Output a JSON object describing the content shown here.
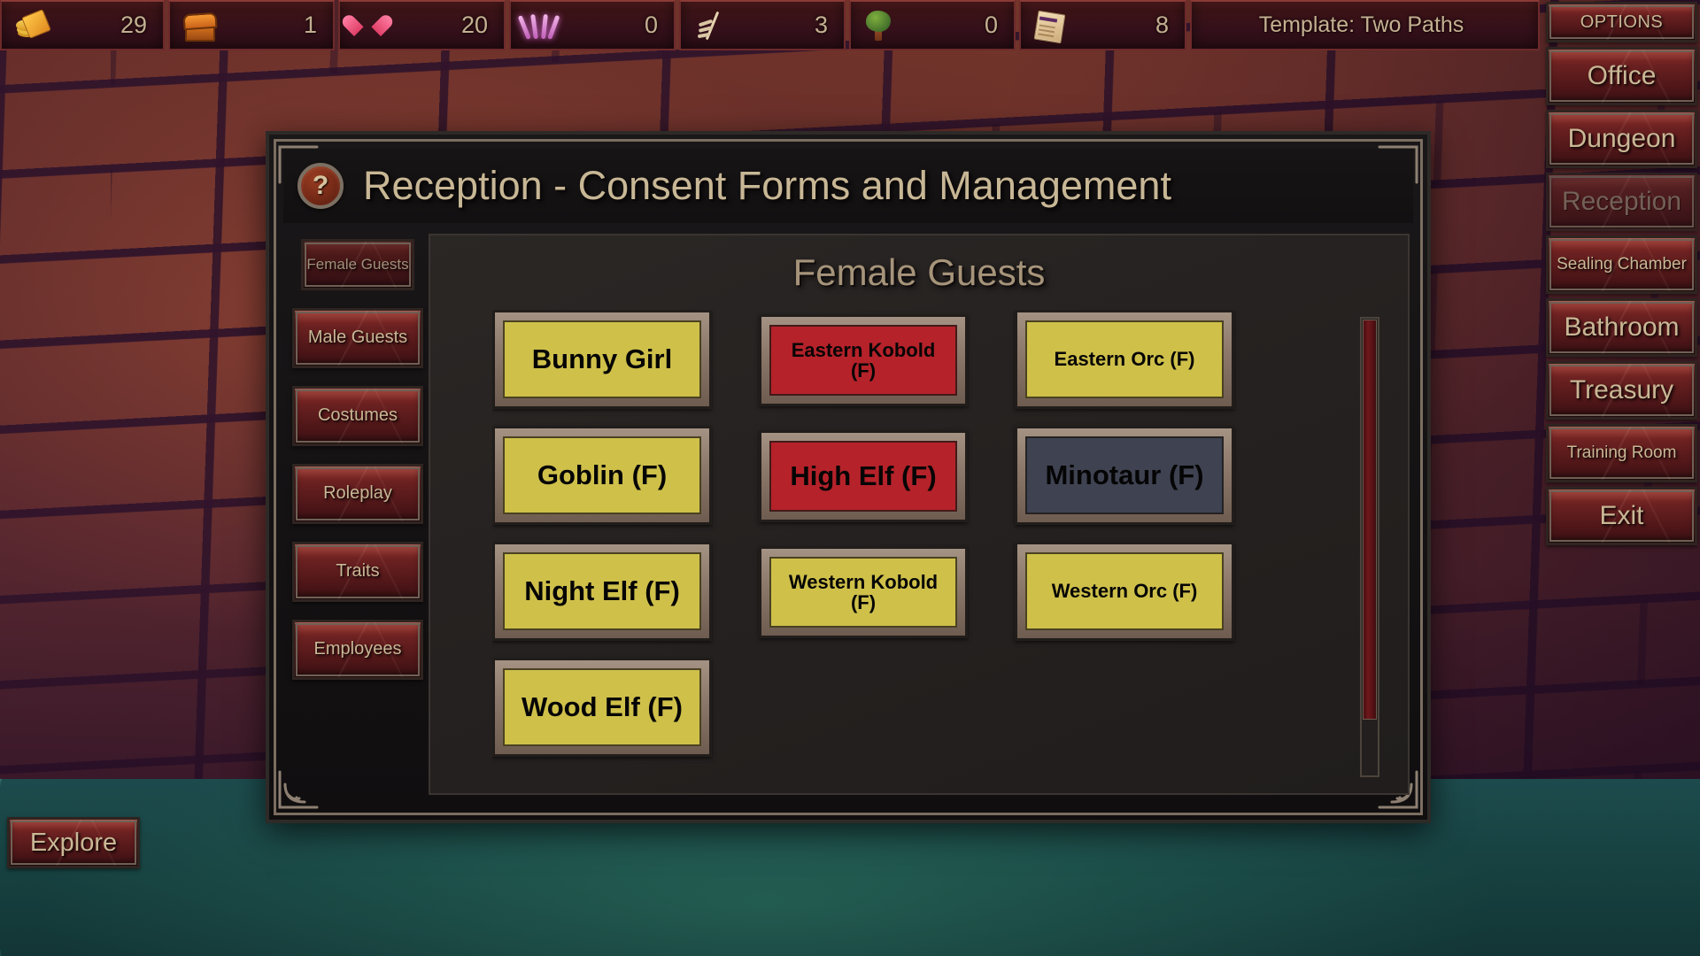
{
  "topbar": {
    "resources": [
      {
        "icon": "gold-coins-icon",
        "id": "cell-gold",
        "value": "29"
      },
      {
        "icon": "treasure-chest-icon",
        "id": "cell-chest",
        "value": "1"
      },
      {
        "icon": "heart-icon",
        "id": "cell-heart",
        "value": "20"
      },
      {
        "icon": "magic-bone-icon",
        "id": "cell-bone",
        "value": "0"
      },
      {
        "icon": "skeleton-spear-icon",
        "id": "cell-skel",
        "value": "3"
      },
      {
        "icon": "tree-icon",
        "id": "cell-wood",
        "value": "0"
      },
      {
        "icon": "scroll-papers-icon",
        "id": "cell-scroll",
        "value": "8"
      }
    ],
    "template_label": "Template: Two Paths"
  },
  "rightnav": {
    "options_label": "OPTIONS",
    "rooms": [
      {
        "label": "Office",
        "size": "large",
        "state": "normal"
      },
      {
        "label": "Dungeon",
        "size": "large",
        "state": "normal"
      },
      {
        "label": "Reception",
        "size": "large",
        "state": "current"
      },
      {
        "label": "Sealing Chamber",
        "size": "small",
        "state": "normal"
      },
      {
        "label": "Bathroom",
        "size": "large",
        "state": "normal"
      },
      {
        "label": "Treasury",
        "size": "large",
        "state": "normal"
      },
      {
        "label": "Training Room",
        "size": "small",
        "state": "normal"
      },
      {
        "label": "Exit",
        "size": "large",
        "state": "normal"
      }
    ]
  },
  "explore_label": "Explore",
  "dialog": {
    "help_glyph": "?",
    "title": "Reception - Consent Forms and Management",
    "tabs": [
      {
        "label": "Female Guests",
        "active": true
      },
      {
        "label": "Male Guests",
        "active": false
      },
      {
        "label": "Costumes",
        "active": false
      },
      {
        "label": "Roleplay",
        "active": false
      },
      {
        "label": "Traits",
        "active": false
      },
      {
        "label": "Employees",
        "active": false
      }
    ],
    "panel_heading": "Female Guests",
    "guests": [
      {
        "label": "Bunny Girl",
        "color": "yellow",
        "text": "large",
        "inset": false
      },
      {
        "label": "Eastern Kobold (F)",
        "color": "red",
        "text": "small",
        "inset": true
      },
      {
        "label": "Eastern Orc (F)",
        "color": "yellow",
        "text": "small",
        "inset": false
      },
      {
        "label": "Goblin (F)",
        "color": "yellow",
        "text": "large",
        "inset": false
      },
      {
        "label": "High Elf (F)",
        "color": "red",
        "text": "large",
        "inset": true
      },
      {
        "label": "Minotaur (F)",
        "color": "slate",
        "text": "large",
        "inset": false
      },
      {
        "label": "Night Elf (F)",
        "color": "yellow",
        "text": "large",
        "inset": false
      },
      {
        "label": "Western Kobold (F)",
        "color": "yellow",
        "text": "small",
        "inset": true
      },
      {
        "label": "Western Orc (F)",
        "color": "yellow",
        "text": "small",
        "inset": false
      },
      {
        "label": "Wood Elf (F)",
        "color": "yellow",
        "text": "large",
        "inset": false
      }
    ]
  },
  "colors": {
    "consent_yellow": "#cfc04a",
    "consent_red": "#b5222a",
    "consent_slate": "#3f4251",
    "parchment_text": "#c8b795",
    "stone_red": "#6a2020"
  }
}
